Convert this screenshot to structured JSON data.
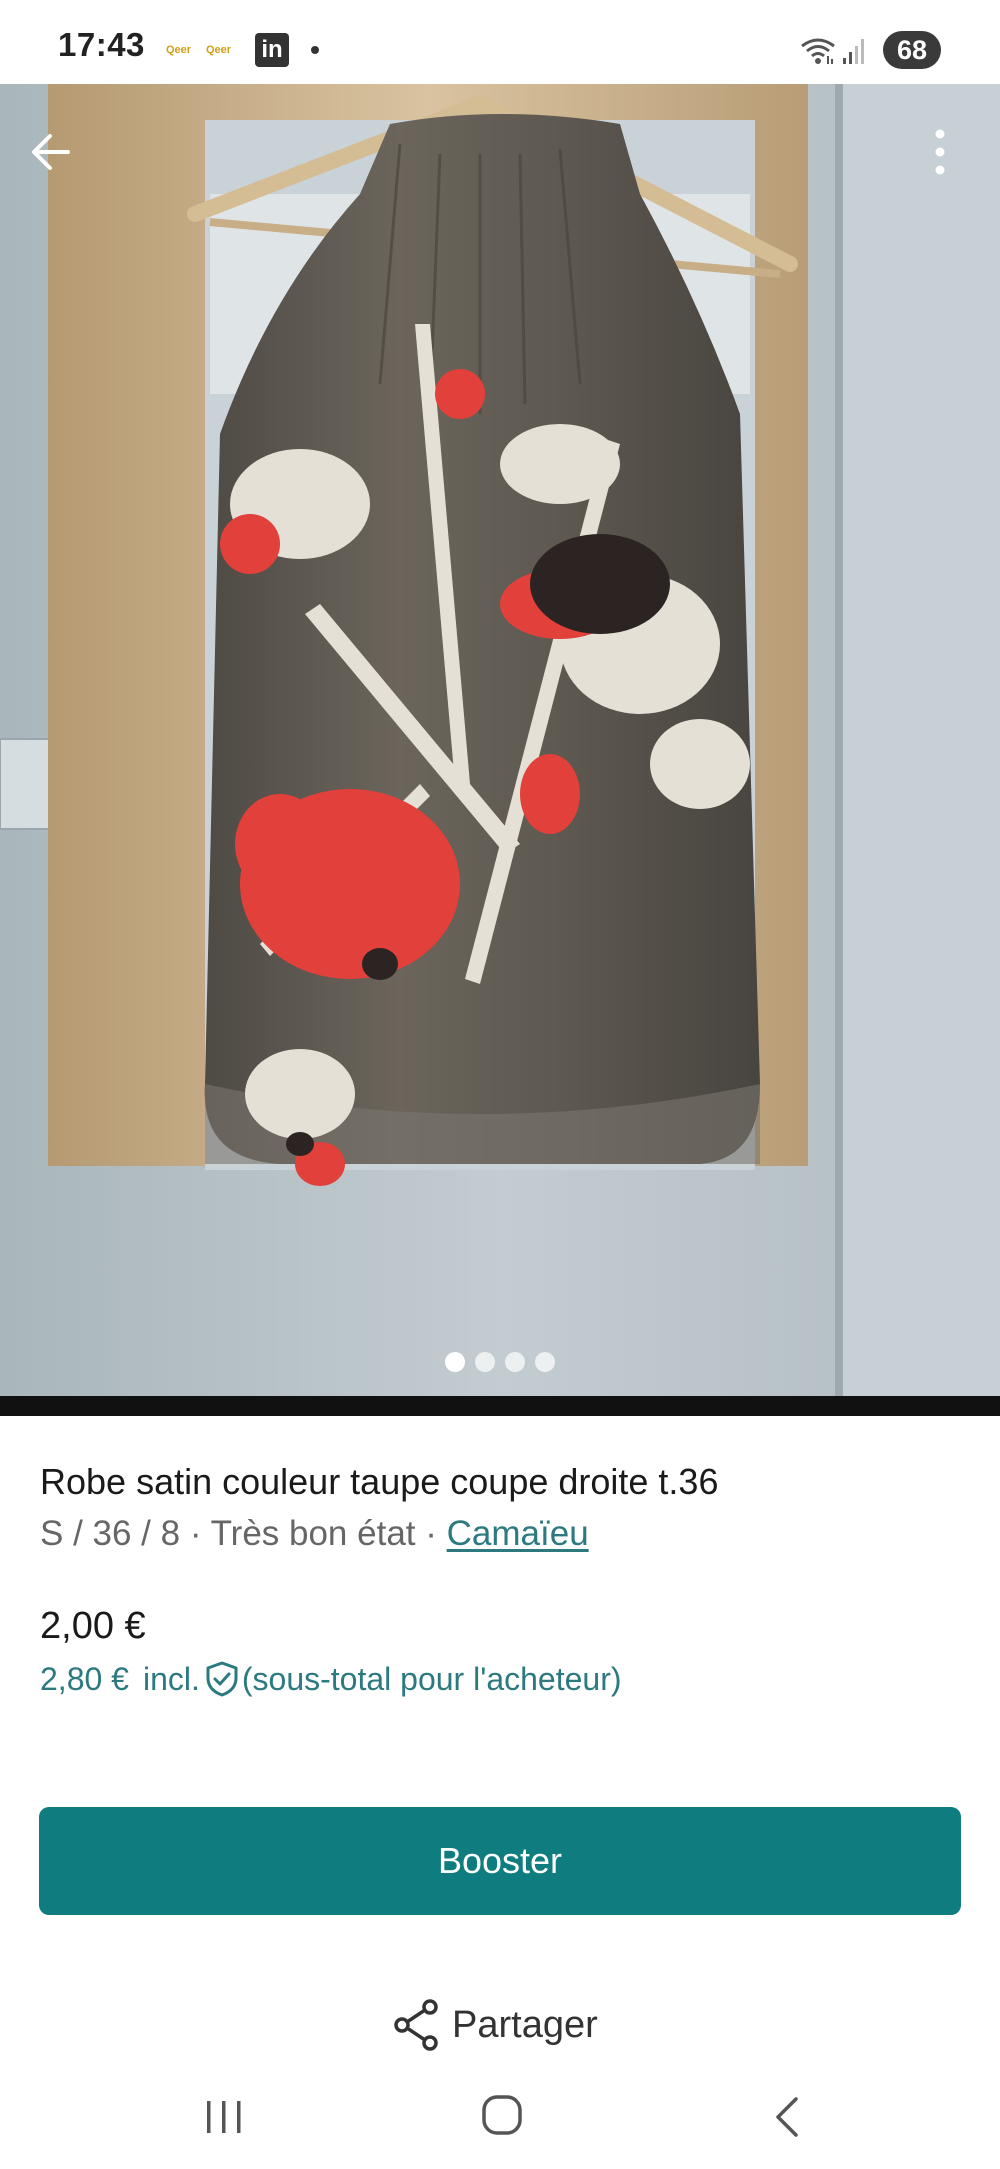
{
  "status_bar": {
    "time": "17:43",
    "notif_app_1": "Qeer",
    "notif_app_2": "Qeer",
    "linkedin_glyph": "in",
    "battery": "68",
    "icons": [
      "linkedin-icon",
      "wifi-icon",
      "signal-icon"
    ]
  },
  "gallery": {
    "image_count": 4,
    "active_index": 0,
    "icons": [
      "back-arrow-icon",
      "more-vert-icon"
    ]
  },
  "item": {
    "title": "Robe satin couleur taupe coupe droite t.36",
    "size": "S / 36 / 8",
    "separator": "·",
    "condition": "Très bon état",
    "brand": "Camaïeu",
    "price": "2,00 €",
    "buyer_price": "2,80 €",
    "buyer_incl": "incl.",
    "buyer_note": "(sous-total pour l'acheteur)"
  },
  "actions": {
    "booster_label": "Booster",
    "share_label": "Partager"
  },
  "nav_bar": {
    "icons": [
      "recent-apps-icon",
      "home-icon",
      "nav-back-icon"
    ]
  },
  "colors": {
    "accent": "#0f7c80",
    "link": "#2c7a80",
    "meta_text": "#666666"
  }
}
